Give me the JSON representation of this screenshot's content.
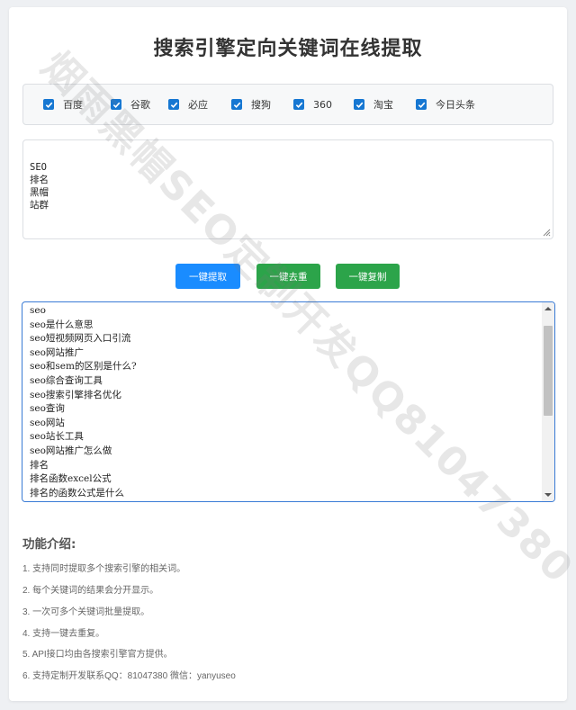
{
  "title": "搜索引擎定向关键词在线提取",
  "engines": [
    {
      "label": "百度",
      "checked": true
    },
    {
      "label": "谷歌",
      "checked": true
    },
    {
      "label": "必应",
      "checked": true
    },
    {
      "label": "搜狗",
      "checked": true
    },
    {
      "label": "360",
      "checked": true
    },
    {
      "label": "淘宝",
      "checked": true
    },
    {
      "label": "今日头条",
      "checked": true
    }
  ],
  "keyword_input": {
    "value": "SEO\n排名\n黑帽\n站群"
  },
  "buttons": {
    "extract": "一键提取",
    "dedupe": "一键去重",
    "copy": "一键复制"
  },
  "results": [
    "seo",
    "seo是什么意思",
    "seo短视频网页入口引流",
    "seo网站推广",
    "seo和sem的区别是什么?",
    "seo综合查询工具",
    "seo搜索引擎排名优化",
    "seo查询",
    "seo网站",
    "seo站长工具",
    "seo网站推广怎么做",
    "排名",
    "排名函数excel公式",
    "排名的函数公式是什么"
  ],
  "features": {
    "title": "功能介绍:",
    "items": [
      "1. 支持同时提取多个搜索引擎的相关词。",
      "2. 每个关键词的结果会分开显示。",
      "3. 一次可多个关键词批量提取。",
      "4. 支持一键去重复。",
      "5. API接口均由各搜索引擎官方提供。",
      "6. 支持定制开发联系QQ：81047380 微信：yanyuseo"
    ]
  },
  "watermark": "烟雨黑帽SEO定制开发QQ81047380",
  "colors": {
    "primary_blue": "#1a8cff",
    "success_green": "#2ca44a",
    "checkbox_blue": "#1677d2",
    "focus_border": "#3a7bd5"
  }
}
